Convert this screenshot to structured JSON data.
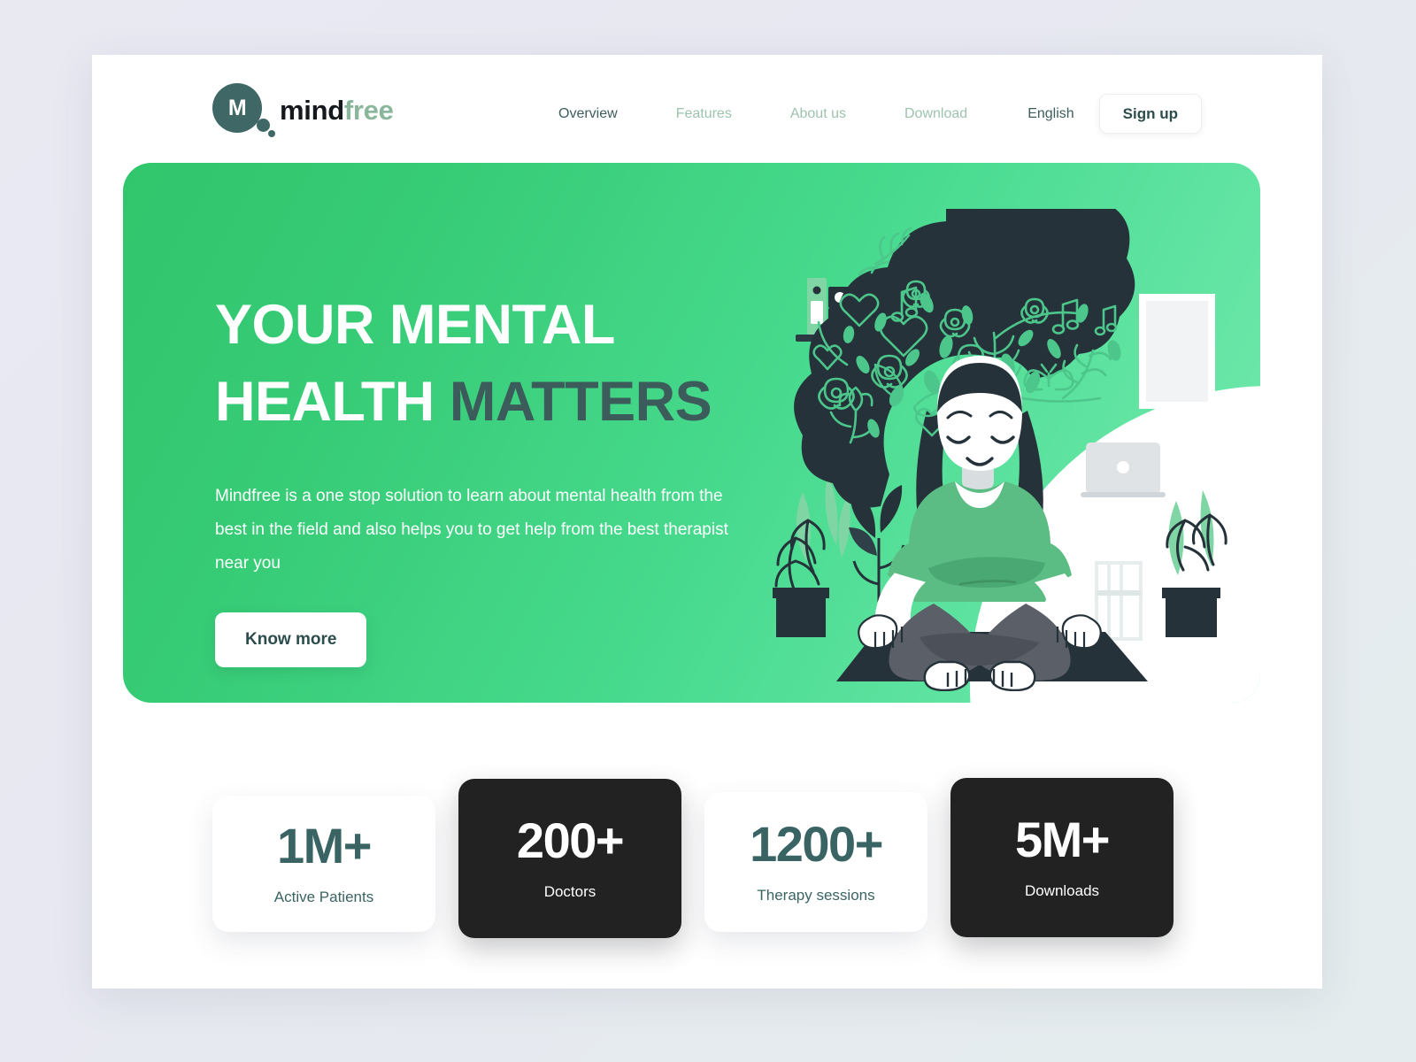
{
  "brand": {
    "mark_letter": "M",
    "name_bold": "mind",
    "name_light": "free"
  },
  "nav": {
    "items": [
      {
        "label": "Overview",
        "active": true
      },
      {
        "label": "Features",
        "active": false
      },
      {
        "label": "About us",
        "active": false
      },
      {
        "label": "Download",
        "active": false
      }
    ],
    "language": "English",
    "signup_label": "Sign up"
  },
  "hero": {
    "title_line1": "YOUR MENTAL",
    "title_line2_white": "HEALTH ",
    "title_line2_accent": "MATTERS",
    "paragraph": "Mindfree is a one stop solution to learn about mental health from the best in the field and also helps you to get help from the best therapist near you",
    "cta_label": "Know more",
    "gradient_from": "#31c56c",
    "gradient_to": "#78eab0",
    "accent_text_color": "#3b5c5b",
    "illustration_alt": "woman-meditating-in-lotus-pose-with-blooming-thoughts"
  },
  "stats": [
    {
      "value": "1M+",
      "label": "Active Patients",
      "theme": "light"
    },
    {
      "value": "200+",
      "label": "Doctors",
      "theme": "dark"
    },
    {
      "value": "1200+",
      "label": "Therapy sessions",
      "theme": "light"
    },
    {
      "value": "5M+",
      "label": "Downloads",
      "theme": "dark"
    }
  ],
  "colors": {
    "page_background": "#e8e9f1",
    "card_background": "#ffffff",
    "brand_teal": "#3f6765",
    "brand_light_green": "#8ab79b",
    "nav_inactive": "#9cc4ad",
    "nav_active": "#3d5e5c",
    "dark_card": "#222222",
    "illustration_dark": "#25323a"
  }
}
